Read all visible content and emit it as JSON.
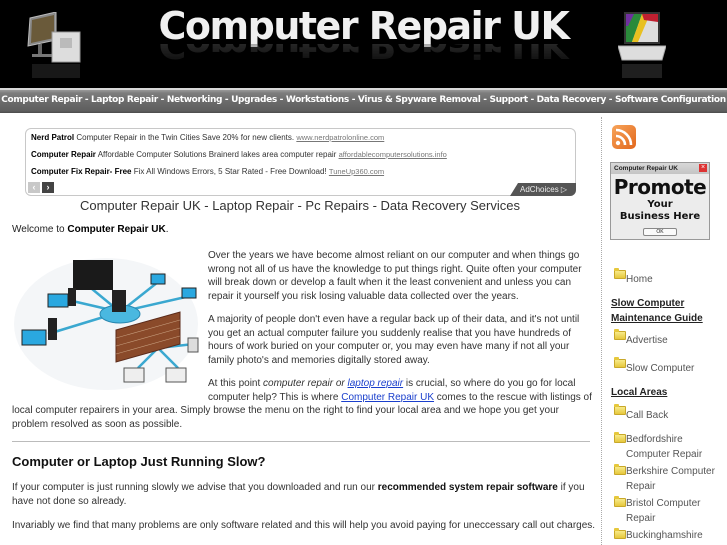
{
  "header": {
    "site_title": "Computer Repair UK"
  },
  "nav": {
    "items": [
      "Computer Repair",
      "Laptop Repair",
      "Networking",
      "Upgrades",
      "Workstations",
      "Virus & Spyware Removal",
      "Support",
      "Data Recovery",
      "Software Configuration"
    ],
    "separator": " - "
  },
  "ads": {
    "rows": [
      {
        "title": "Nerd Patrol",
        "text": "Computer Repair in the Twin Cities Save 20% for new clients.",
        "url": "www.nerdpatrolonline.com"
      },
      {
        "title": "Computer Repair",
        "text": "Affordable Computer Solutions Brainerd lakes area computer repair",
        "url": "affordablecomputersolutions.info"
      },
      {
        "title": "Computer Fix Repair- Free",
        "text": "Fix All Windows Errors, 5 Star Rated - Free Download!",
        "url": "TuneUp360.com"
      }
    ],
    "prev_icon": "‹",
    "next_icon": "›",
    "adchoices_label": "AdChoices ▷"
  },
  "main": {
    "tagline": "Computer Repair UK - Laptop Repair - Pc Repairs - Data Recovery Services",
    "welcome_prefix": "Welcome to ",
    "welcome_bold": "Computer Repair UK",
    "welcome_suffix": ".",
    "p1": "Over the years we have become almost reliant on our computer and when things go wrong not all of us have the knowledge to put things right. Quite often your computer will break down or develop a fault when it the least convenient and unless you can repair it yourself you risk losing valuable data collected over the years.",
    "p2": "A majority of people don't even have a regular back up of their data, and it's not until you get an actual computer failure you suddenly realise that you have hundreds of hours of work buried on your computer or, you may even have many if not all your family photo's and memories digitally stored away.",
    "p3_part1": "At this point ",
    "p3_italic": "computer repair or ",
    "p3_link1": "laptop repair",
    "p3_part2": " is crucial, so where do you go for local computer help? This is where ",
    "p3_link2": "Computer Repair UK",
    "p3_part3": " comes to the rescue with listings of",
    "p3_cont": "local computer repairers in your area. Simply browse the menu on the right to find your local area and we hope you get your problem resolved as soon as possible.",
    "section_heading": "Computer or Laptop Just Running Slow?",
    "p4_part1": "If your computer is just running slowly we advise that you downloaded and run our ",
    "p4_bold": "recommended system repair software",
    "p4_part2": " if you have not done so already.",
    "p5": "Invariably we find that many problems are only software related and this will help you avoid paying for uneccessary call out charges."
  },
  "sidebar": {
    "promo": {
      "window_title": "Computer Repair UK",
      "big": "Promote",
      "line1": "Your",
      "line2": "Business Here",
      "ok": "OK"
    },
    "links": [
      {
        "label": "Home"
      },
      {
        "heading": "Slow Computer Maintenance Guide"
      },
      {
        "label": "Advertise"
      },
      {
        "label": "Slow Computer"
      },
      {
        "heading": "Local Areas"
      },
      {
        "label": "Call Back"
      },
      {
        "label": "Bedfordshire Computer Repair"
      },
      {
        "label": "Berkshire Computer Repair"
      },
      {
        "label": "Bristol Computer Repair"
      },
      {
        "label": "Buckinghamshire"
      }
    ]
  }
}
